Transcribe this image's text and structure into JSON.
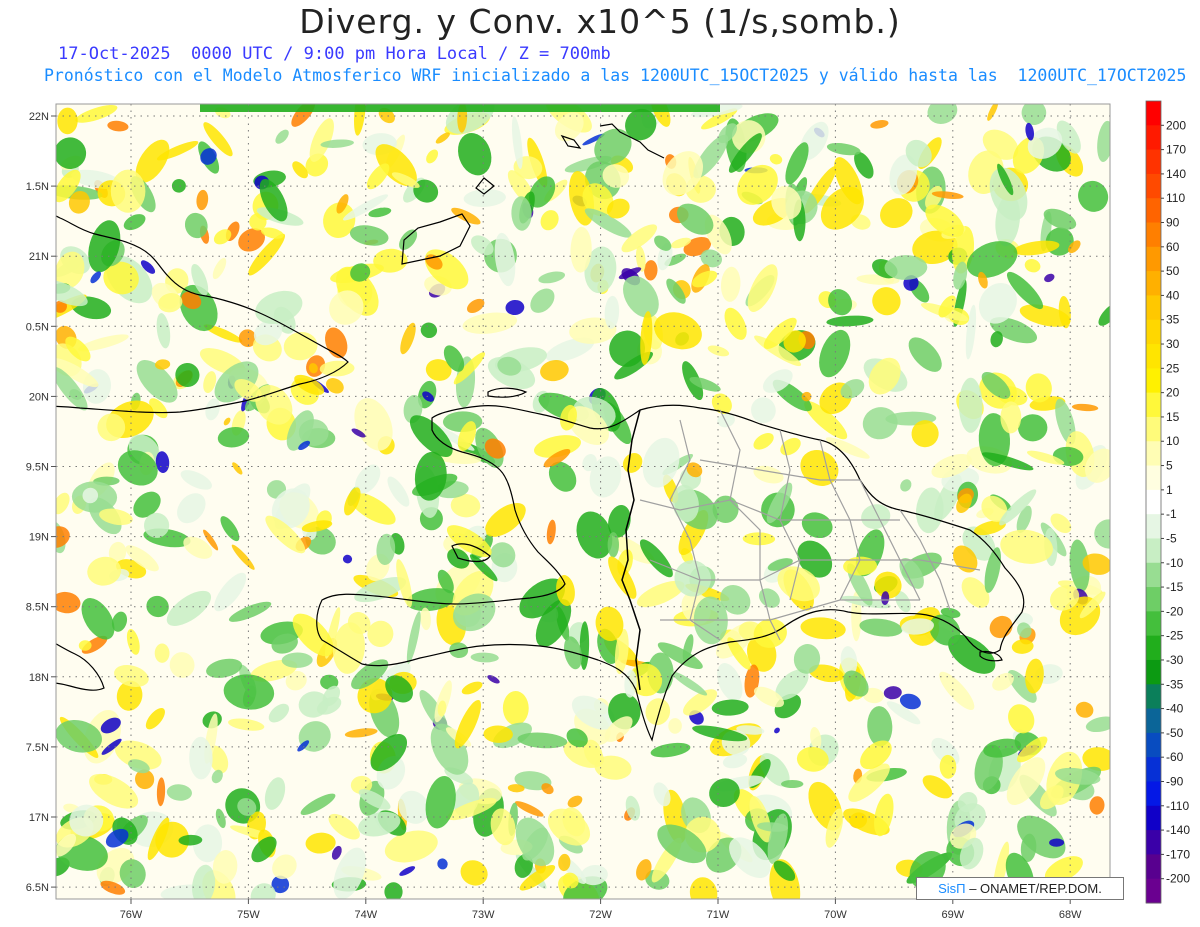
{
  "header": {
    "title": "Diverg. y Conv. x10^5 (1/s,somb.)",
    "subtitle_time": "17-Oct-2025  0000 UTC / 9:00 pm Hora Local / Z = 700mb",
    "subtitle_model": "Pronóstico con el Modelo Atmosferico WRF inicializado a las 1200UTC_15OCT2025 y válido hasta las  1200UTC_17OCT2025"
  },
  "axes": {
    "lat_labels": [
      "22N",
      "1.5N",
      "21N",
      "0.5N",
      "20N",
      "9.5N",
      "19N",
      "8.5N",
      "18N",
      "7.5N",
      "17N",
      "6.5N"
    ],
    "lon_labels": [
      "76W",
      "75W",
      "74W",
      "73W",
      "72W",
      "71W",
      "70W",
      "69W",
      "68W"
    ]
  },
  "colorbar": {
    "labels": [
      "200",
      "170",
      "140",
      "110",
      "90",
      "60",
      "50",
      "40",
      "35",
      "30",
      "25",
      "20",
      "15",
      "10",
      "5",
      "1",
      "-1",
      "-5",
      "-10",
      "-15",
      "-20",
      "-25",
      "-30",
      "-35",
      "-40",
      "-50",
      "-60",
      "-90",
      "-110",
      "-140",
      "-170",
      "-200"
    ],
    "colors": [
      "#ff0000",
      "#ff1a00",
      "#ff3300",
      "#ff4a00",
      "#ff6400",
      "#ff7f00",
      "#ff9900",
      "#ffb000",
      "#ffc800",
      "#ffd700",
      "#ffe500",
      "#fff100",
      "#fff83a",
      "#fffb7a",
      "#fffdb4",
      "#fffee0",
      "#ffffff",
      "#e6f6e4",
      "#c8eec4",
      "#98dd92",
      "#6ece66",
      "#44bf3c",
      "#21ae1c",
      "#0c9a12",
      "#0b7f5a",
      "#0b6598",
      "#084cc0",
      "#0630d6",
      "#0418e6",
      "#1000c8",
      "#3a00a8",
      "#58008f",
      "#6a0090"
    ]
  },
  "legend_colors": {
    "coast": "#000000",
    "borders": "#a0a0a0",
    "grid": "#7a7a7a"
  },
  "credit": {
    "brand": "SisΠ",
    "text": " – ONAMET/REP.DOM."
  }
}
